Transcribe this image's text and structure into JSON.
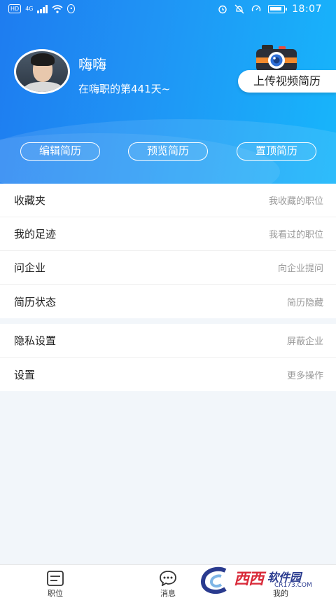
{
  "status_bar": {
    "left_chip_1": "HD",
    "left_chip_2": "4G",
    "right_time": "18:07"
  },
  "profile": {
    "name": "嗨嗨",
    "subtitle": "在嗨职的第441天~",
    "upload_label": "上传视频简历"
  },
  "actions": [
    {
      "label": "编辑简历"
    },
    {
      "label": "预览简历"
    },
    {
      "label": "置顶简历"
    }
  ],
  "menu": {
    "group1": [
      {
        "label": "收藏夹",
        "hint": "我收藏的职位"
      },
      {
        "label": "我的足迹",
        "hint": "我看过的职位"
      },
      {
        "label": "问企业",
        "hint": "向企业提问"
      },
      {
        "label": "简历状态",
        "hint": "简历隐藏"
      }
    ],
    "group2": [
      {
        "label": "隐私设置",
        "hint": "屏蔽企业"
      },
      {
        "label": "设置",
        "hint": "更多操作"
      }
    ]
  },
  "bottom_nav": [
    {
      "label": "职位",
      "icon": "list-icon"
    },
    {
      "label": "消息",
      "icon": "chat-icon"
    },
    {
      "label": "我的",
      "icon": "user-icon"
    }
  ],
  "watermark": {
    "main": "西西",
    "brand": "软件园",
    "sub": "CR173.COM"
  },
  "colors": {
    "header_start": "#1e7cf0",
    "header_end": "#17b6fb"
  }
}
